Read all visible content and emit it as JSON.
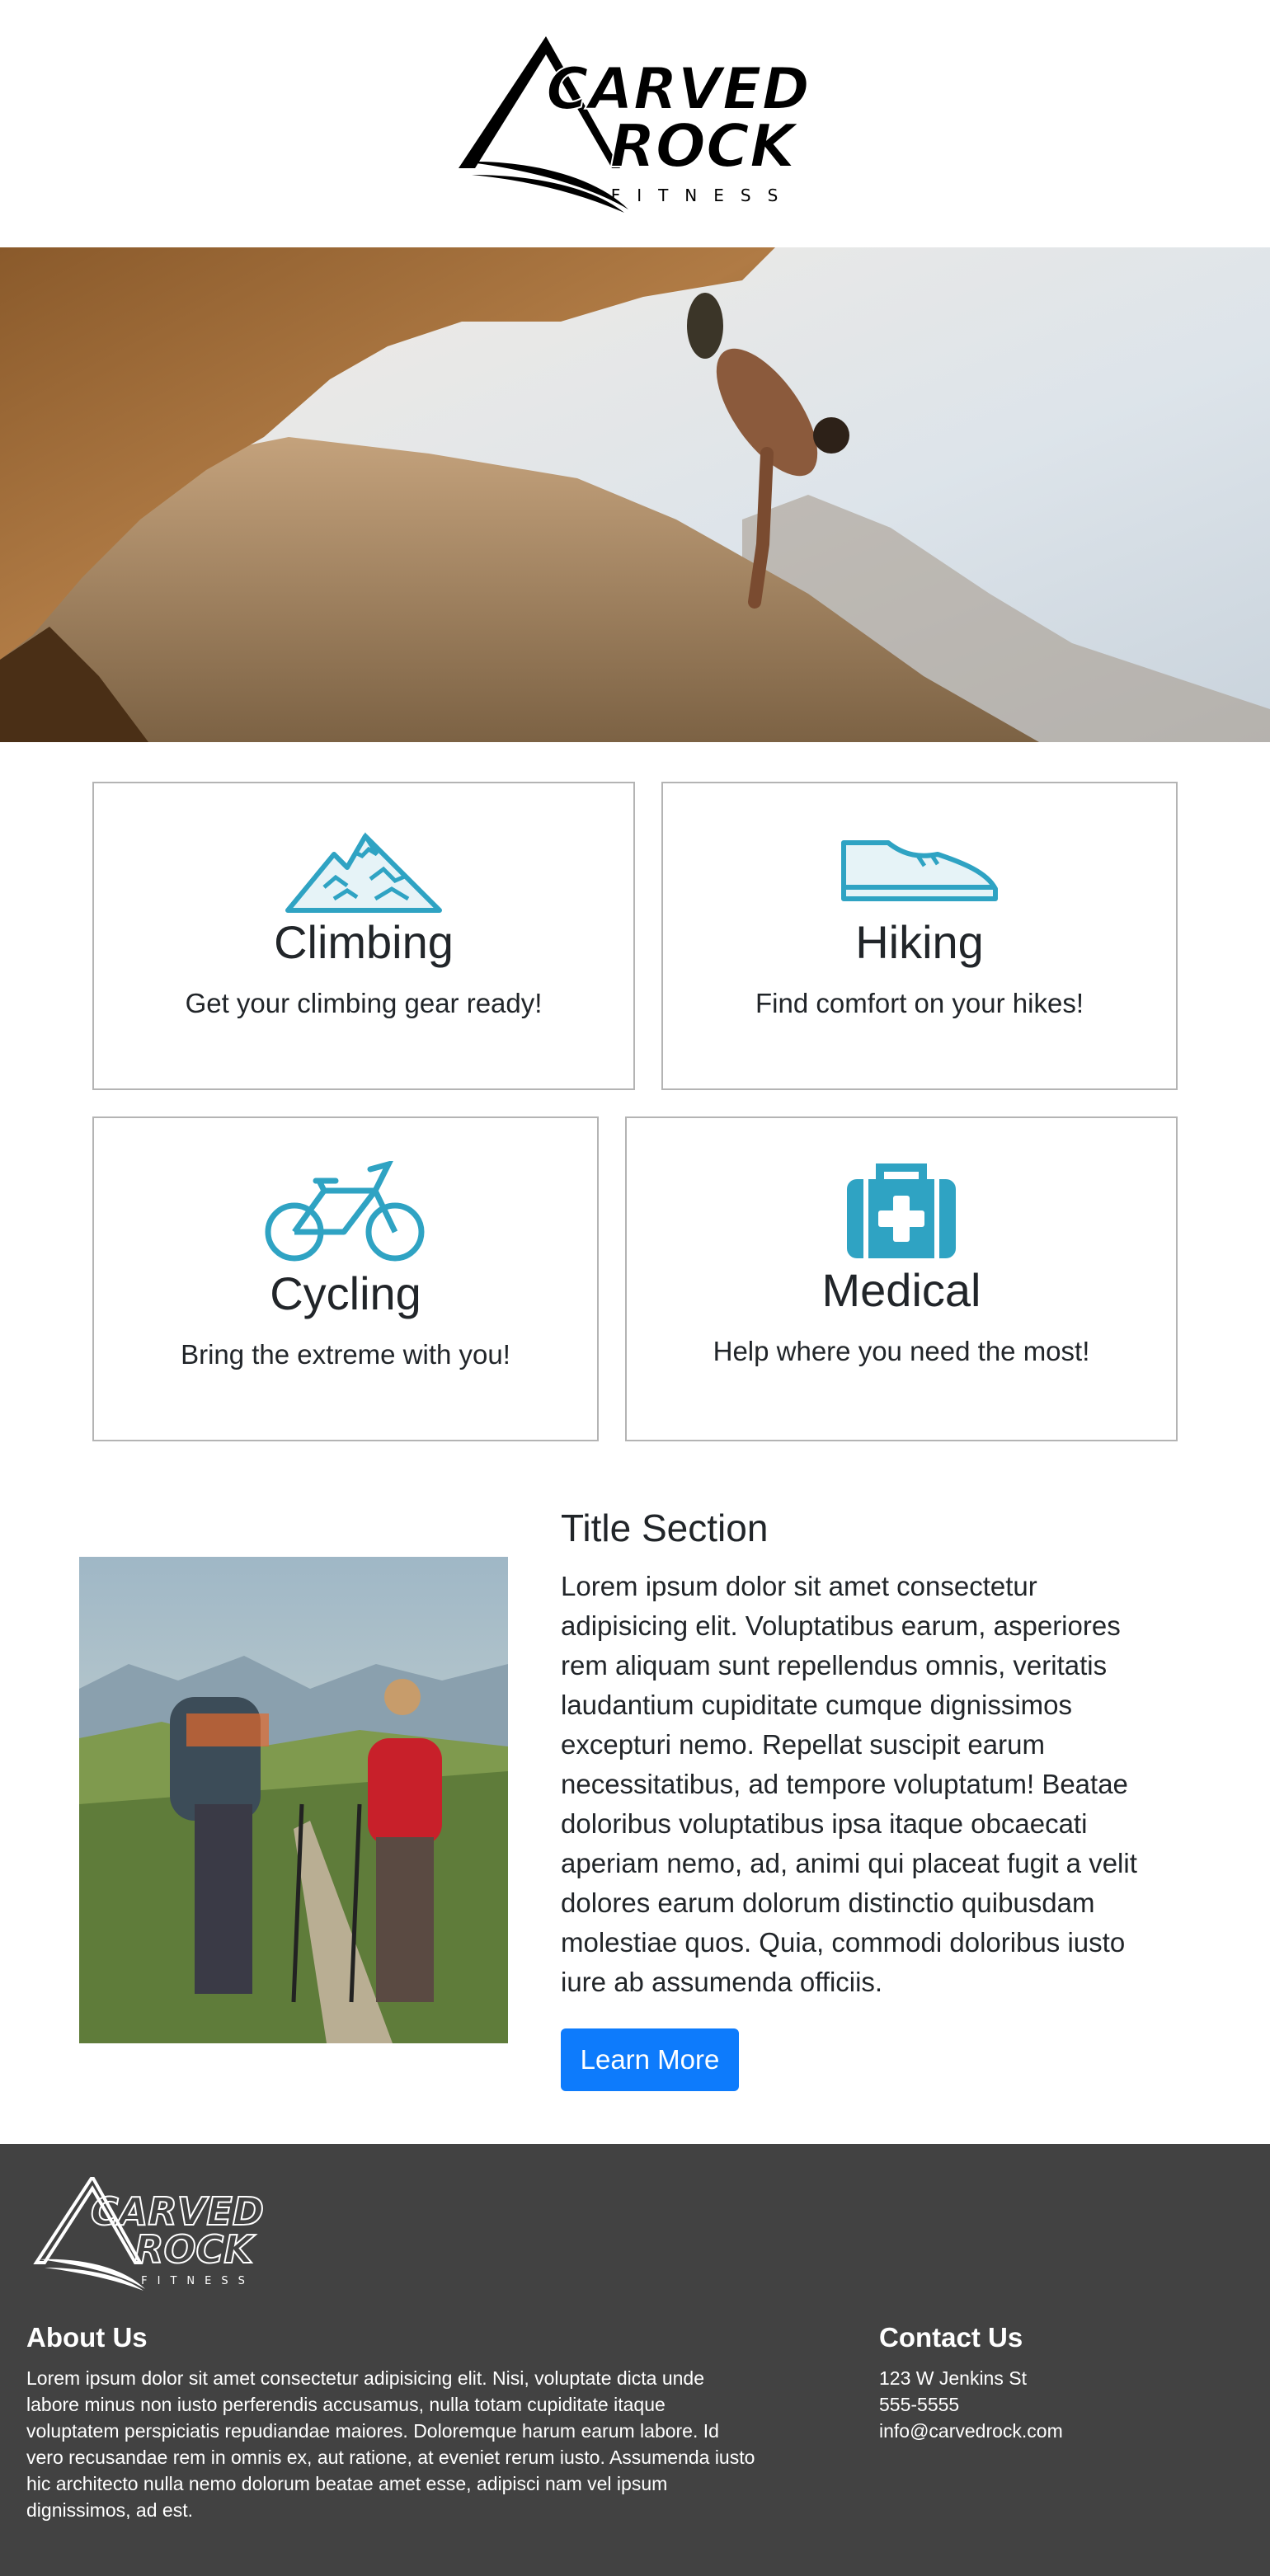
{
  "brand": {
    "logo_line1": "CARVED",
    "logo_line2": "ROCK",
    "logo_line3": "FITNESS"
  },
  "colors": {
    "accent_icon": "#2fa3c3",
    "button": "#0d7bfc",
    "footer_bg": "#424242"
  },
  "cards": [
    {
      "icon": "mountain-icon",
      "title": "Climbing",
      "text": "Get your climbing gear ready!"
    },
    {
      "icon": "shoe-icon",
      "title": "Hiking",
      "text": "Find comfort on your hikes!"
    },
    {
      "icon": "bicycle-icon",
      "title": "Cycling",
      "text": "Bring the extreme with you!"
    },
    {
      "icon": "medical-kit-icon",
      "title": "Medical",
      "text": "Help where you need the most!"
    }
  ],
  "section": {
    "title": "Title Section",
    "body": "Lorem ipsum dolor sit amet consectetur adipisicing elit. Voluptatibus earum, asperiores rem aliquam sunt repellendus omnis, veritatis laudantium cupiditate cumque dignissimos excepturi nemo. Repellat suscipit earum necessitatibus, ad tempore voluptatum! Beatae doloribus voluptatibus ipsa itaque obcaecati aperiam nemo, ad, animi qui placeat fugit a velit dolores earum dolorum distinctio quibusdam molestiae quos. Quia, commodi doloribus iusto iure ab assumenda officiis.",
    "button": "Learn More"
  },
  "footer": {
    "about_title": "About Us",
    "about_text": "Lorem ipsum dolor sit amet consectetur adipisicing elit. Nisi, voluptate dicta unde labore minus non iusto perferendis accusamus, nulla totam cupiditate itaque voluptatem perspiciatis repudiandae maiores. Doloremque harum earum labore. Id vero recusandae rem in omnis ex, aut ratione, at eveniet rerum iusto. Assumenda iusto hic architecto nulla nemo dolorum beatae amet esse, adipisci nam vel ipsum dignissimos, ad est.",
    "contact_title": "Contact Us",
    "address": "123 W Jenkins St",
    "phone": "555-5555",
    "email": "info@carvedrock.com"
  }
}
